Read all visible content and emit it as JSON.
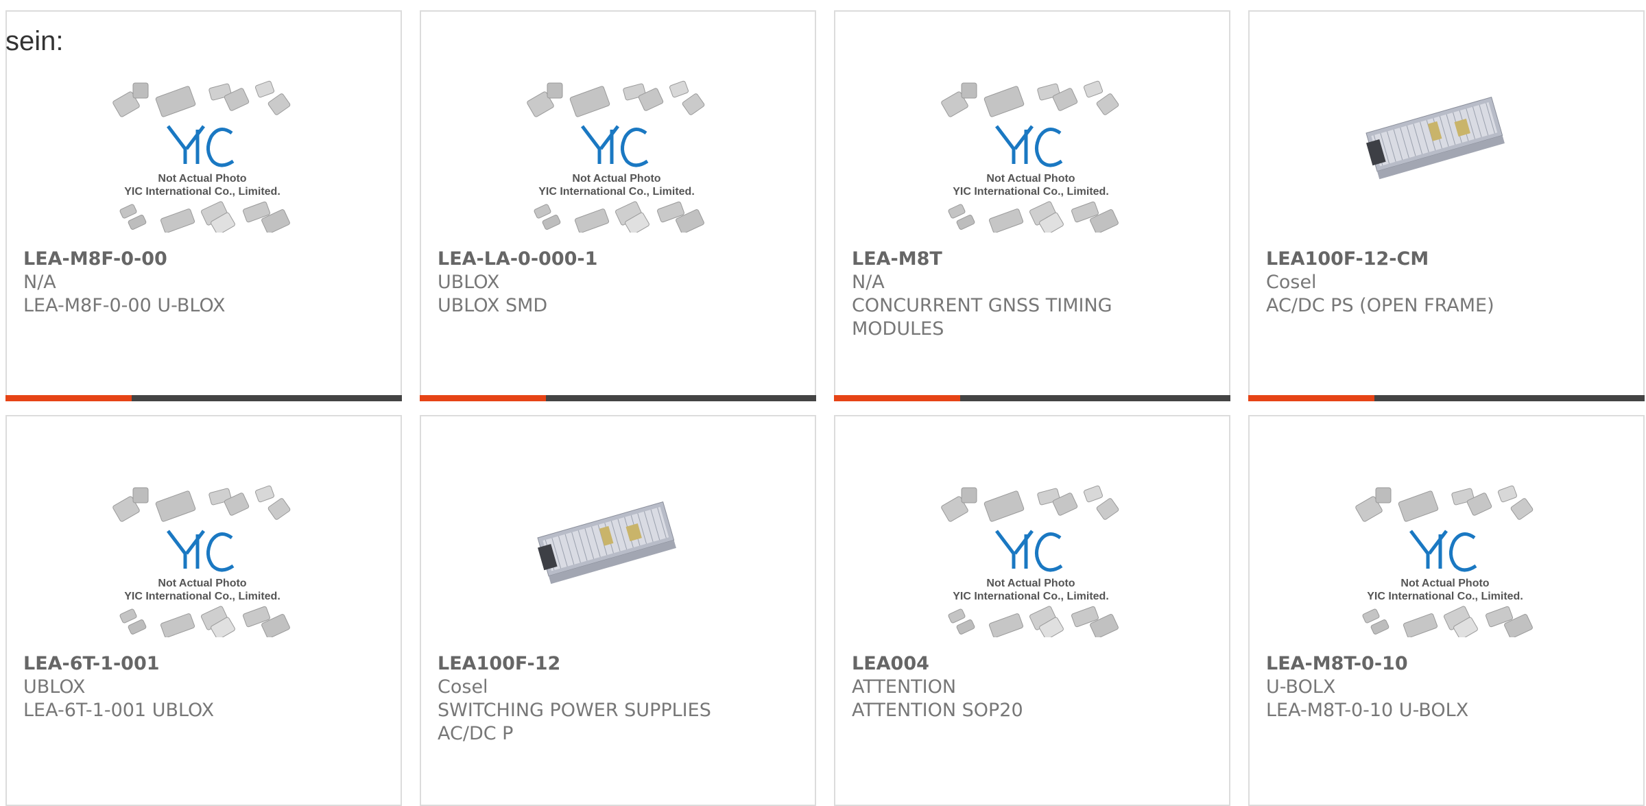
{
  "heading": "sein:",
  "placeholder_image": {
    "line1": "Not Actual Photo",
    "line2": "YIC International Co., Limited.",
    "brand_color": "#1a78c2"
  },
  "colors": {
    "accent": "#e64416",
    "bar": "#444444",
    "border": "#dcdcdc"
  },
  "products": [
    {
      "part_number": "LEA-M8F-0-00",
      "manufacturer": "N/A",
      "description": "LEA-M8F-0-00 U-BLOX",
      "image": "placeholder"
    },
    {
      "part_number": "LEA-LA-0-000-1",
      "manufacturer": "UBLOX",
      "description": "UBLOX SMD",
      "image": "placeholder"
    },
    {
      "part_number": "LEA-M8T",
      "manufacturer": "N/A",
      "description": "CONCURRENT GNSS TIMING MODULES",
      "image": "placeholder"
    },
    {
      "part_number": "LEA100F-12-CM",
      "manufacturer": "Cosel",
      "description": "AC/DC PS (OPEN FRAME)",
      "image": "power-supply"
    },
    {
      "part_number": "LEA-6T-1-001",
      "manufacturer": "UBLOX",
      "description": "LEA-6T-1-001 UBLOX",
      "image": "placeholder"
    },
    {
      "part_number": "LEA100F-12",
      "manufacturer": "Cosel",
      "description": "SWITCHING POWER SUPPLIES AC/DC P",
      "image": "power-supply"
    },
    {
      "part_number": "LEA004",
      "manufacturer": "ATTENTION",
      "description": "ATTENTION SOP20",
      "image": "placeholder"
    },
    {
      "part_number": "LEA-M8T-0-10",
      "manufacturer": "U-BOLX",
      "description": "LEA-M8T-0-10 U-BOLX",
      "image": "placeholder"
    }
  ]
}
